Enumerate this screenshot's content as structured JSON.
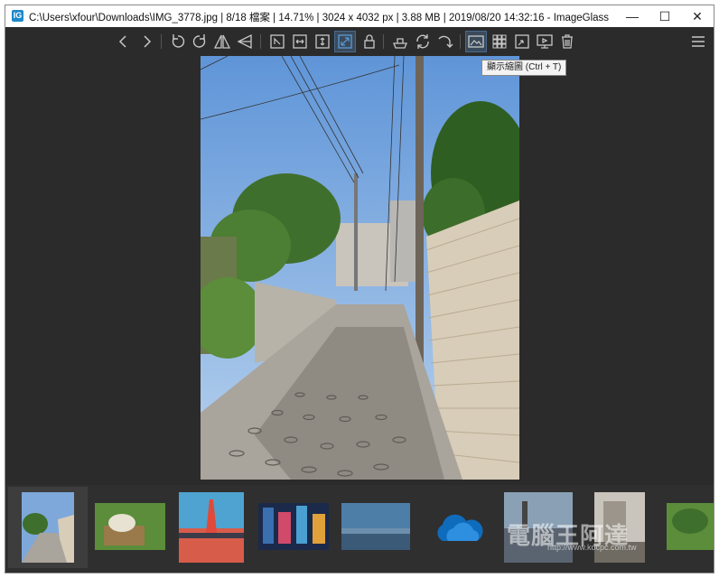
{
  "window": {
    "title": "C:\\Users\\xfour\\Downloads\\IMG_3778.jpg  |  8/18 檔案  |  14.71%  |  3024 x 4032 px  |  3.88 MB  |  2019/08/20 14:32:16  - ImageGlass",
    "app_icon_glyph": "IG",
    "minimize": "—",
    "maximize": "☐",
    "close": "✕"
  },
  "tooltip": {
    "text": "顯示縮圖 (Ctrl + T)"
  },
  "toolbar": {
    "icons": [
      "previous-icon",
      "next-icon",
      "rotate-left-icon",
      "rotate-right-icon",
      "flip-horizontal-icon",
      "flip-vertical-icon",
      "auto-zoom-icon",
      "fit-width-icon",
      "fit-height-icon",
      "scale-to-fit-icon",
      "lock-zoom-icon",
      "checkerboard-icon",
      "slideshow-icon",
      "refresh-icon",
      "goto-icon",
      "thumbnail-icon",
      "gallery-icon",
      "fullscreen-icon",
      "slideshow-screen-icon",
      "delete-icon",
      "menu-icon"
    ],
    "active": "scale-to-fit-icon",
    "icon_color": "#c8c8c8",
    "active_color": "#5b9bd5"
  },
  "thumbnails": [
    {
      "name": "IMG_3778.jpg",
      "selected": true
    },
    {
      "name": "thumb-2"
    },
    {
      "name": "thumb-3"
    },
    {
      "name": "thumb-4"
    },
    {
      "name": "thumb-5"
    },
    {
      "name": "onedrive-thumb"
    },
    {
      "name": "thumb-7"
    },
    {
      "name": "thumb-8"
    },
    {
      "name": "thumb-9"
    }
  ],
  "watermark": {
    "text": "電腦王阿達",
    "url": "http://www.kocpc.com.tw"
  },
  "colors": {
    "background": "#2b2b2b",
    "accent": "#1e88c9"
  }
}
